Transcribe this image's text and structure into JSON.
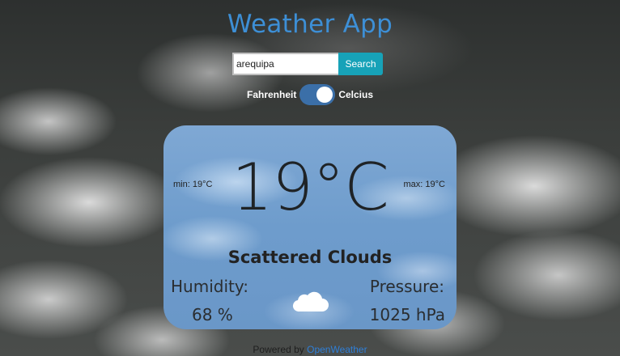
{
  "app": {
    "title": "Weather App"
  },
  "search": {
    "value": "arequipa",
    "button_label": "Search"
  },
  "units": {
    "left_label": "Fahrenheit",
    "right_label": "Celcius",
    "selected": "Celcius"
  },
  "weather": {
    "min": "min: 19°C",
    "max": "max: 19°C",
    "temperature": "19°C",
    "description": "Scattered Clouds",
    "humidity_label": "Humidity:",
    "humidity_value": "68 %",
    "pressure_label": "Pressure:",
    "pressure_value": "1025 hPa",
    "icon": "cloud-icon"
  },
  "footer": {
    "prefix": "Powered by",
    "link_label": "OpenWeather"
  },
  "colors": {
    "title": "#3d8fd6",
    "search_button": "#17a2b8",
    "toggle": "#3b6fa8",
    "link": "#2f7fd8"
  }
}
